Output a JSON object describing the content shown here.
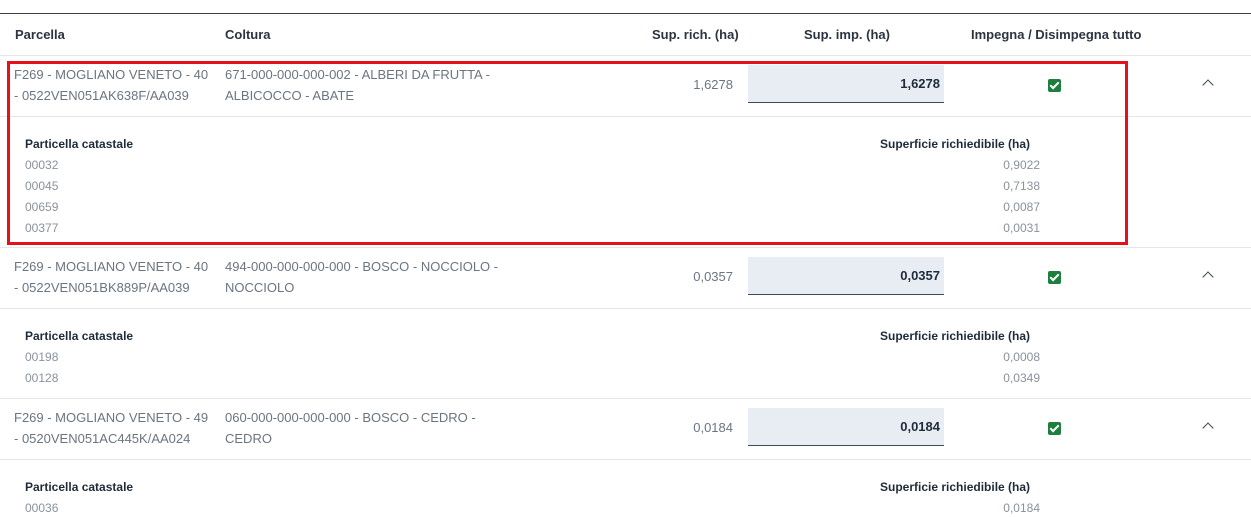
{
  "header": {
    "parcella": "Parcella",
    "coltura": "Coltura",
    "sup_rich": "Sup. rich. (ha)",
    "sup_imp": "Sup. imp. (ha)",
    "impegna": "Impegna / Disimpegna tutto"
  },
  "rows": [
    {
      "parcella_line1": "F269 - MOGLIANO VENETO - 40",
      "parcella_line2": "- 0522VEN051AK638F/AA039",
      "coltura_line1": "671-000-000-000-002 - ALBERI DA FRUTTA -",
      "coltura_line2": "ALBICOCCO - ABATE",
      "sup_rich": "1,6278",
      "sup_imp": "1,6278",
      "detail": {
        "left_title": "Particella catastale",
        "right_title": "Superficie richiedibile (ha)",
        "particelle": [
          "00032",
          "00045",
          "00659",
          "00377"
        ],
        "superfici": [
          "0,9022",
          "0,7138",
          "0,0087",
          "0,0031"
        ]
      }
    },
    {
      "parcella_line1": "F269 - MOGLIANO VENETO - 40",
      "parcella_line2": "- 0522VEN051BK889P/AA039",
      "coltura_line1": "494-000-000-000-000 - BOSCO - NOCCIOLO -",
      "coltura_line2": "NOCCIOLO",
      "sup_rich": "0,0357",
      "sup_imp": "0,0357",
      "detail": {
        "left_title": "Particella catastale",
        "right_title": "Superficie richiedibile (ha)",
        "particelle": [
          "00198",
          "00128"
        ],
        "superfici": [
          "0,0008",
          "0,0349"
        ]
      }
    },
    {
      "parcella_line1": "F269 - MOGLIANO VENETO - 49",
      "parcella_line2": "- 0520VEN051AC445K/AA024",
      "coltura_line1": "060-000-000-000-000 - BOSCO - CEDRO -",
      "coltura_line2": "CEDRO",
      "sup_rich": "0,0184",
      "sup_imp": "0,0184",
      "detail": {
        "left_title": "Particella catastale",
        "right_title": "Superficie richiedibile (ha)",
        "particelle": [
          "00036"
        ],
        "superfici": [
          "0,0184"
        ]
      }
    }
  ]
}
